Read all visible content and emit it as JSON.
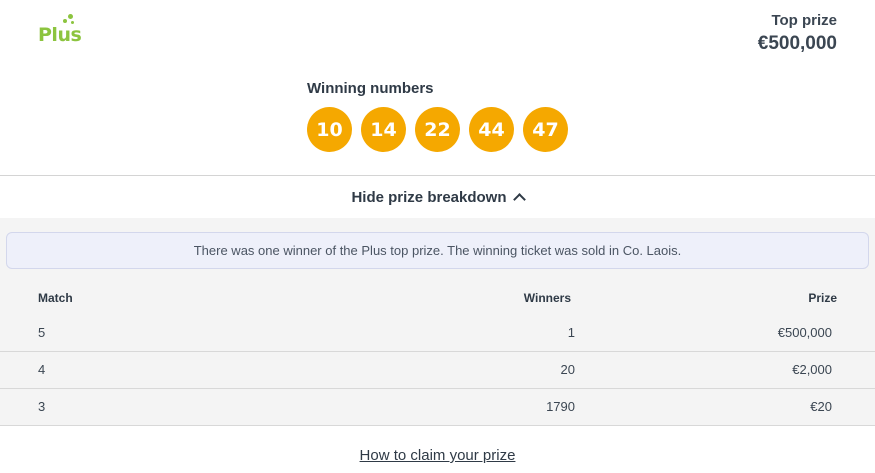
{
  "logo": {
    "text": "Plus",
    "color": "#8cc43f"
  },
  "top_prize": {
    "label": "Top prize",
    "value": "€500,000"
  },
  "winning_numbers": {
    "label": "Winning numbers",
    "balls": [
      "10",
      "14",
      "22",
      "44",
      "47"
    ],
    "ball_color": "#f5a800"
  },
  "breakdown": {
    "toggle_label": "Hide prize breakdown",
    "toggle_icon": "chevron-up-icon",
    "notice": "There was one winner of the Plus top prize. The winning ticket was sold in Co. Laois.",
    "columns": {
      "match": "Match",
      "winners": "Winners",
      "prize": "Prize"
    },
    "rows": [
      {
        "match": "5",
        "winners": "1",
        "prize": "€500,000"
      },
      {
        "match": "4",
        "winners": "20",
        "prize": "€2,000"
      },
      {
        "match": "3",
        "winners": "1790",
        "prize": "€20"
      }
    ]
  },
  "claim_link": "How to claim your prize"
}
